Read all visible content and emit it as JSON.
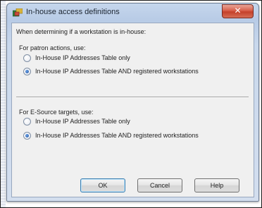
{
  "window": {
    "title": "In-house access definitions",
    "close_glyph": "✕",
    "icons": {
      "app": "app-icon",
      "close": "close-icon"
    }
  },
  "intro": "When determining if a workstation is in-house:",
  "patron_section": {
    "heading": "For patron actions, use:",
    "options": [
      {
        "label": "In-House IP Addresses Table only",
        "selected": false
      },
      {
        "label": "In-House IP Addresses Table AND registered workstations",
        "selected": true
      }
    ]
  },
  "esource_section": {
    "heading": "For E-Source targets, use:",
    "options": [
      {
        "label": "In-House IP Addresses Table only",
        "selected": false
      },
      {
        "label": "In-House IP Addresses Table AND registered workstations",
        "selected": true
      }
    ]
  },
  "buttons": {
    "ok": "OK",
    "cancel": "Cancel",
    "help": "Help"
  },
  "colors": {
    "title_gradient_top": "#c5d6ec",
    "client_bg": "#f0f0f0",
    "close_red": "#c4402a",
    "radio_selected": "#1f4f9c"
  }
}
